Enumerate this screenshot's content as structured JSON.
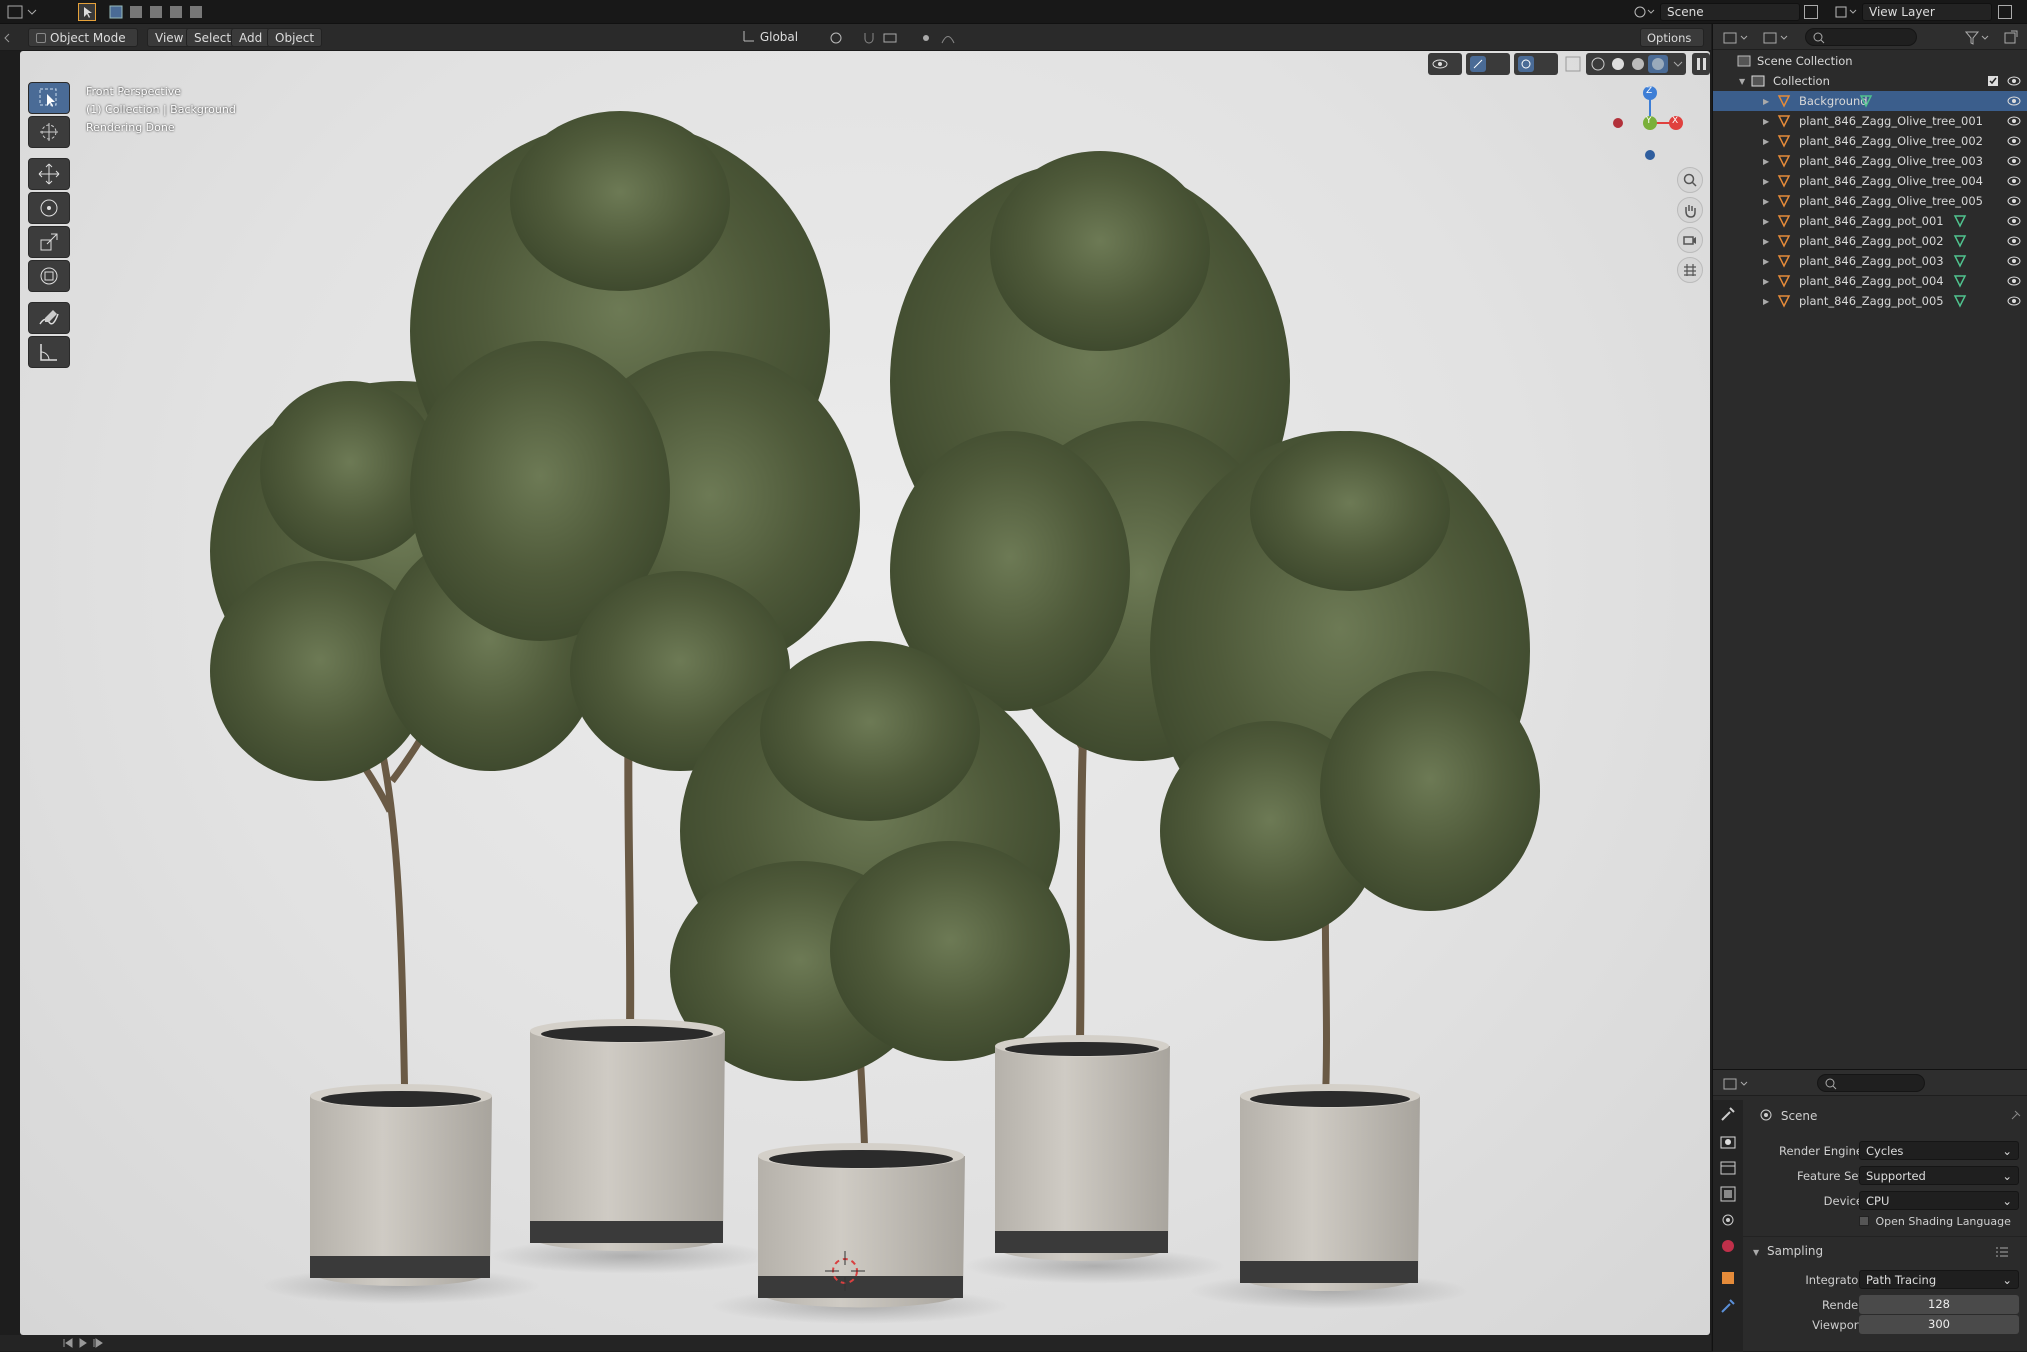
{
  "topbar": {
    "scene_name": "Scene",
    "view_layer": "View Layer"
  },
  "viewport_header": {
    "mode": "Object Mode",
    "menu": [
      "View",
      "Select",
      "Add",
      "Object"
    ],
    "transform_orientation": "Global",
    "options": "Options"
  },
  "viewport": {
    "info": [
      "Front Perspective",
      "(1) Collection | Background",
      "Rendering Done"
    ],
    "gizmo": {
      "z": "Z",
      "y": "Y",
      "x": "X"
    }
  },
  "toolbar": {
    "tools": [
      "select-box-icon",
      "cursor-icon",
      "move-icon",
      "rotate-icon",
      "scale-icon",
      "transform-icon",
      "annotate-icon",
      "measure-icon"
    ]
  },
  "outliner": {
    "scene_collection": "Scene Collection",
    "collection": "Collection",
    "items": [
      {
        "name": "Background",
        "selected": true
      },
      {
        "name": "plant_846_Zagg_Olive_tree_001"
      },
      {
        "name": "plant_846_Zagg_Olive_tree_002"
      },
      {
        "name": "plant_846_Zagg_Olive_tree_003"
      },
      {
        "name": "plant_846_Zagg_Olive_tree_004"
      },
      {
        "name": "plant_846_Zagg_Olive_tree_005"
      },
      {
        "name": "plant_846_Zagg_pot_001"
      },
      {
        "name": "plant_846_Zagg_pot_002"
      },
      {
        "name": "plant_846_Zagg_pot_003"
      },
      {
        "name": "plant_846_Zagg_pot_004"
      },
      {
        "name": "plant_846_Zagg_pot_005"
      }
    ]
  },
  "properties": {
    "context": "Scene",
    "render_engine_label": "Render Engine",
    "render_engine": "Cycles",
    "feature_set_label": "Feature Set",
    "feature_set": "Supported",
    "device_label": "Device",
    "device": "CPU",
    "osl_label": "Open Shading Language",
    "sampling_label": "Sampling",
    "integrator_label": "Integrator",
    "integrator": "Path Tracing",
    "render_label": "Render",
    "render_samples": "128",
    "viewport_label": "Viewport",
    "viewport_samples": "300"
  },
  "colors": {
    "accent_blue": "#4a6b96",
    "selection": "#3b5e8c",
    "mesh_orange": "#e58b3a",
    "mesh_green": "#4fc28e",
    "axis_x": "#e0413e",
    "axis_y": "#7ab03a",
    "axis_z": "#3d7ed6"
  }
}
